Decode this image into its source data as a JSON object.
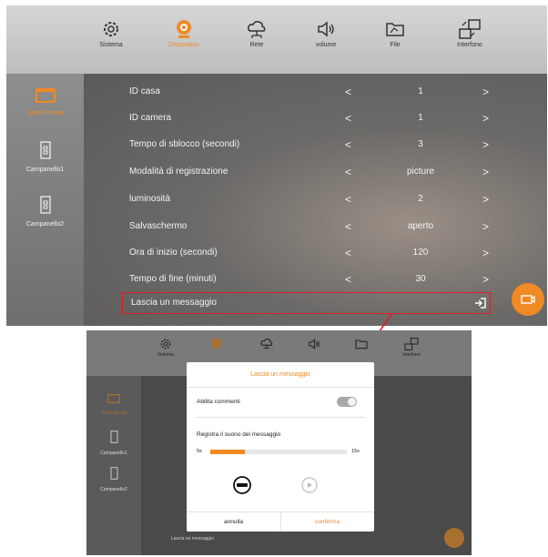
{
  "top": {
    "tabs": [
      {
        "label": "Sistema",
        "icon": "gear-icon",
        "active": false
      },
      {
        "label": "Dispositivo",
        "icon": "webcam-icon",
        "active": true
      },
      {
        "label": "Rete",
        "icon": "cloud-network-icon",
        "active": false
      },
      {
        "label": "volume",
        "icon": "speaker-icon",
        "active": false
      },
      {
        "label": "File",
        "icon": "folder-icon",
        "active": false
      },
      {
        "label": "Interfono",
        "icon": "intercom-icon",
        "active": false
      }
    ],
    "sidebar": [
      {
        "label": "Unità interna",
        "icon": "monitor-icon",
        "active": true
      },
      {
        "label": "Campanello1",
        "icon": "doorbell-icon",
        "active": false
      },
      {
        "label": "Campanello2",
        "icon": "doorbell-icon",
        "active": false
      }
    ],
    "settings": [
      {
        "name": "ID casa",
        "value": "1"
      },
      {
        "name": "ID camera",
        "value": "1"
      },
      {
        "name": "Tempo di sblocco (secondi)",
        "value": "3"
      },
      {
        "name": "Modalità di registrazione",
        "value": "picture"
      },
      {
        "name": "luminosità",
        "value": "2"
      },
      {
        "name": "Salvaschermo",
        "value": "aperto"
      },
      {
        "name": "Ora di inizio (secondi)",
        "value": "120"
      },
      {
        "name": "Tempo di fine (minuti)",
        "value": "30"
      }
    ],
    "message_row": "Lascia un messaggio",
    "prev": "<",
    "next": ">",
    "accent": "#f08a24",
    "highlight": "#d91f26"
  },
  "bottom": {
    "tabs": [
      {
        "label": "Sistema"
      },
      {
        "label": ""
      },
      {
        "label": ""
      },
      {
        "label": ""
      },
      {
        "label": ""
      },
      {
        "label": "Interfono"
      }
    ],
    "sidebar": [
      {
        "label": "Unità interna"
      },
      {
        "label": "Campanello1"
      },
      {
        "label": "Campanello2"
      }
    ],
    "background_row": "Lascia un messaggio",
    "dialog": {
      "title": "Lascia un messaggio",
      "enable_label": "Abilita commenti",
      "enable_on": false,
      "record_label": "Registra il suono del messaggio",
      "min": "5s",
      "max": "15s",
      "progress": 0.25,
      "cancel": "annulla",
      "confirm": "conferma"
    }
  }
}
